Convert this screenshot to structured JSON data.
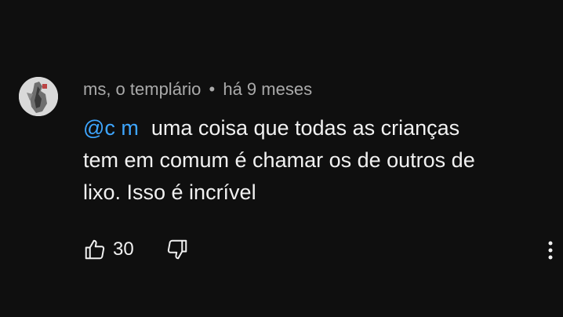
{
  "comment": {
    "author": "ms, o templário",
    "separator": "•",
    "time": "há 9 meses",
    "mention": "@c m",
    "text_line1": "uma coisa que todas as crianças",
    "text_line2": "tem em comum é chamar os de outros de",
    "text_line3": "lixo. Isso é incrível",
    "likes": "30"
  },
  "icons": {
    "like": "thumb-up-icon",
    "dislike": "thumb-down-icon",
    "more": "more-vertical-icon"
  },
  "colors": {
    "background": "#0f0f0f",
    "text": "#f1f1f1",
    "meta": "#aaaaaa",
    "mention": "#3ea6ff"
  }
}
